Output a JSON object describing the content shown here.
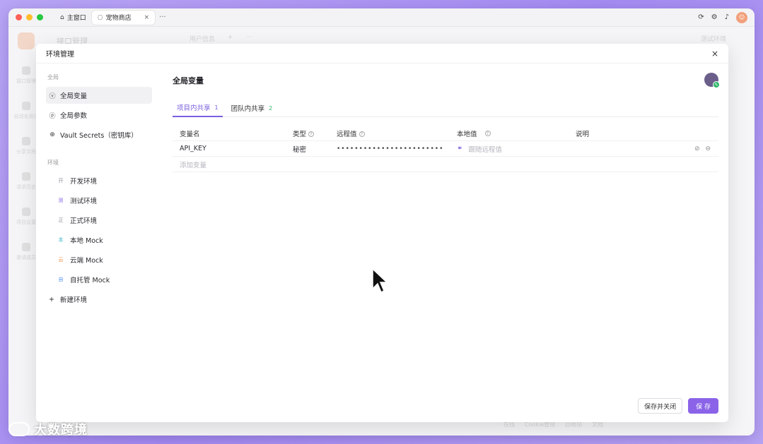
{
  "window": {
    "tabs": [
      {
        "label": "主窗口",
        "icon": "home-icon"
      },
      {
        "label": "宠物商店",
        "icon": "app-icon"
      }
    ],
    "more_label": "···"
  },
  "background": {
    "page_title": "接口管理",
    "tabs": [
      "用户信息",
      "+",
      "···"
    ],
    "env_label": "测试环境",
    "rail": [
      "接口管理",
      "自动化测试",
      "分享文档",
      "请求历史",
      "项目设置",
      "邀请成员"
    ],
    "footer": [
      "在线",
      "Cookie管理",
      "回收站",
      "文档"
    ]
  },
  "modal": {
    "title": "环境管理",
    "close": "×",
    "sections": {
      "global_label": "全局",
      "env_label": "环境"
    },
    "global_items": [
      {
        "label": "全局变量",
        "icon": "variable-icon"
      },
      {
        "label": "全局参数",
        "icon": "param-icon"
      },
      {
        "label": "Vault Secrets（密钥库）",
        "icon": "vault-icon"
      }
    ],
    "envs": [
      {
        "badge": "开",
        "label": "开发环境",
        "color": "#8e8e99"
      },
      {
        "badge": "测",
        "label": "测试环境",
        "color": "#8a63e8"
      },
      {
        "badge": "正",
        "label": "正式环境",
        "color": "#8e8e99"
      },
      {
        "badge": "本",
        "label": "本地 Mock",
        "color": "#3bb7c9"
      },
      {
        "badge": "云",
        "label": "云端 Mock",
        "color": "#f08a3c"
      },
      {
        "badge": "自",
        "label": "自托管 Mock",
        "color": "#4a8cf0"
      }
    ],
    "new_env": "新建环境",
    "main": {
      "title": "全局变量",
      "tabs": [
        {
          "label": "项目内共享",
          "count": "1"
        },
        {
          "label": "团队内共享",
          "count": "2"
        }
      ],
      "columns": [
        "变量名",
        "类型",
        "远程值",
        "本地值",
        "说明"
      ],
      "rows": [
        {
          "name": "API_KEY",
          "type": "秘密",
          "remote": "••••••••••••••••••••••••",
          "local_placeholder": "跟随远程值",
          "desc": ""
        }
      ],
      "add_row": "添加变量"
    },
    "footer": {
      "save_close": "保存并关闭",
      "save": "保 存"
    }
  },
  "watermark": "大数跨境"
}
